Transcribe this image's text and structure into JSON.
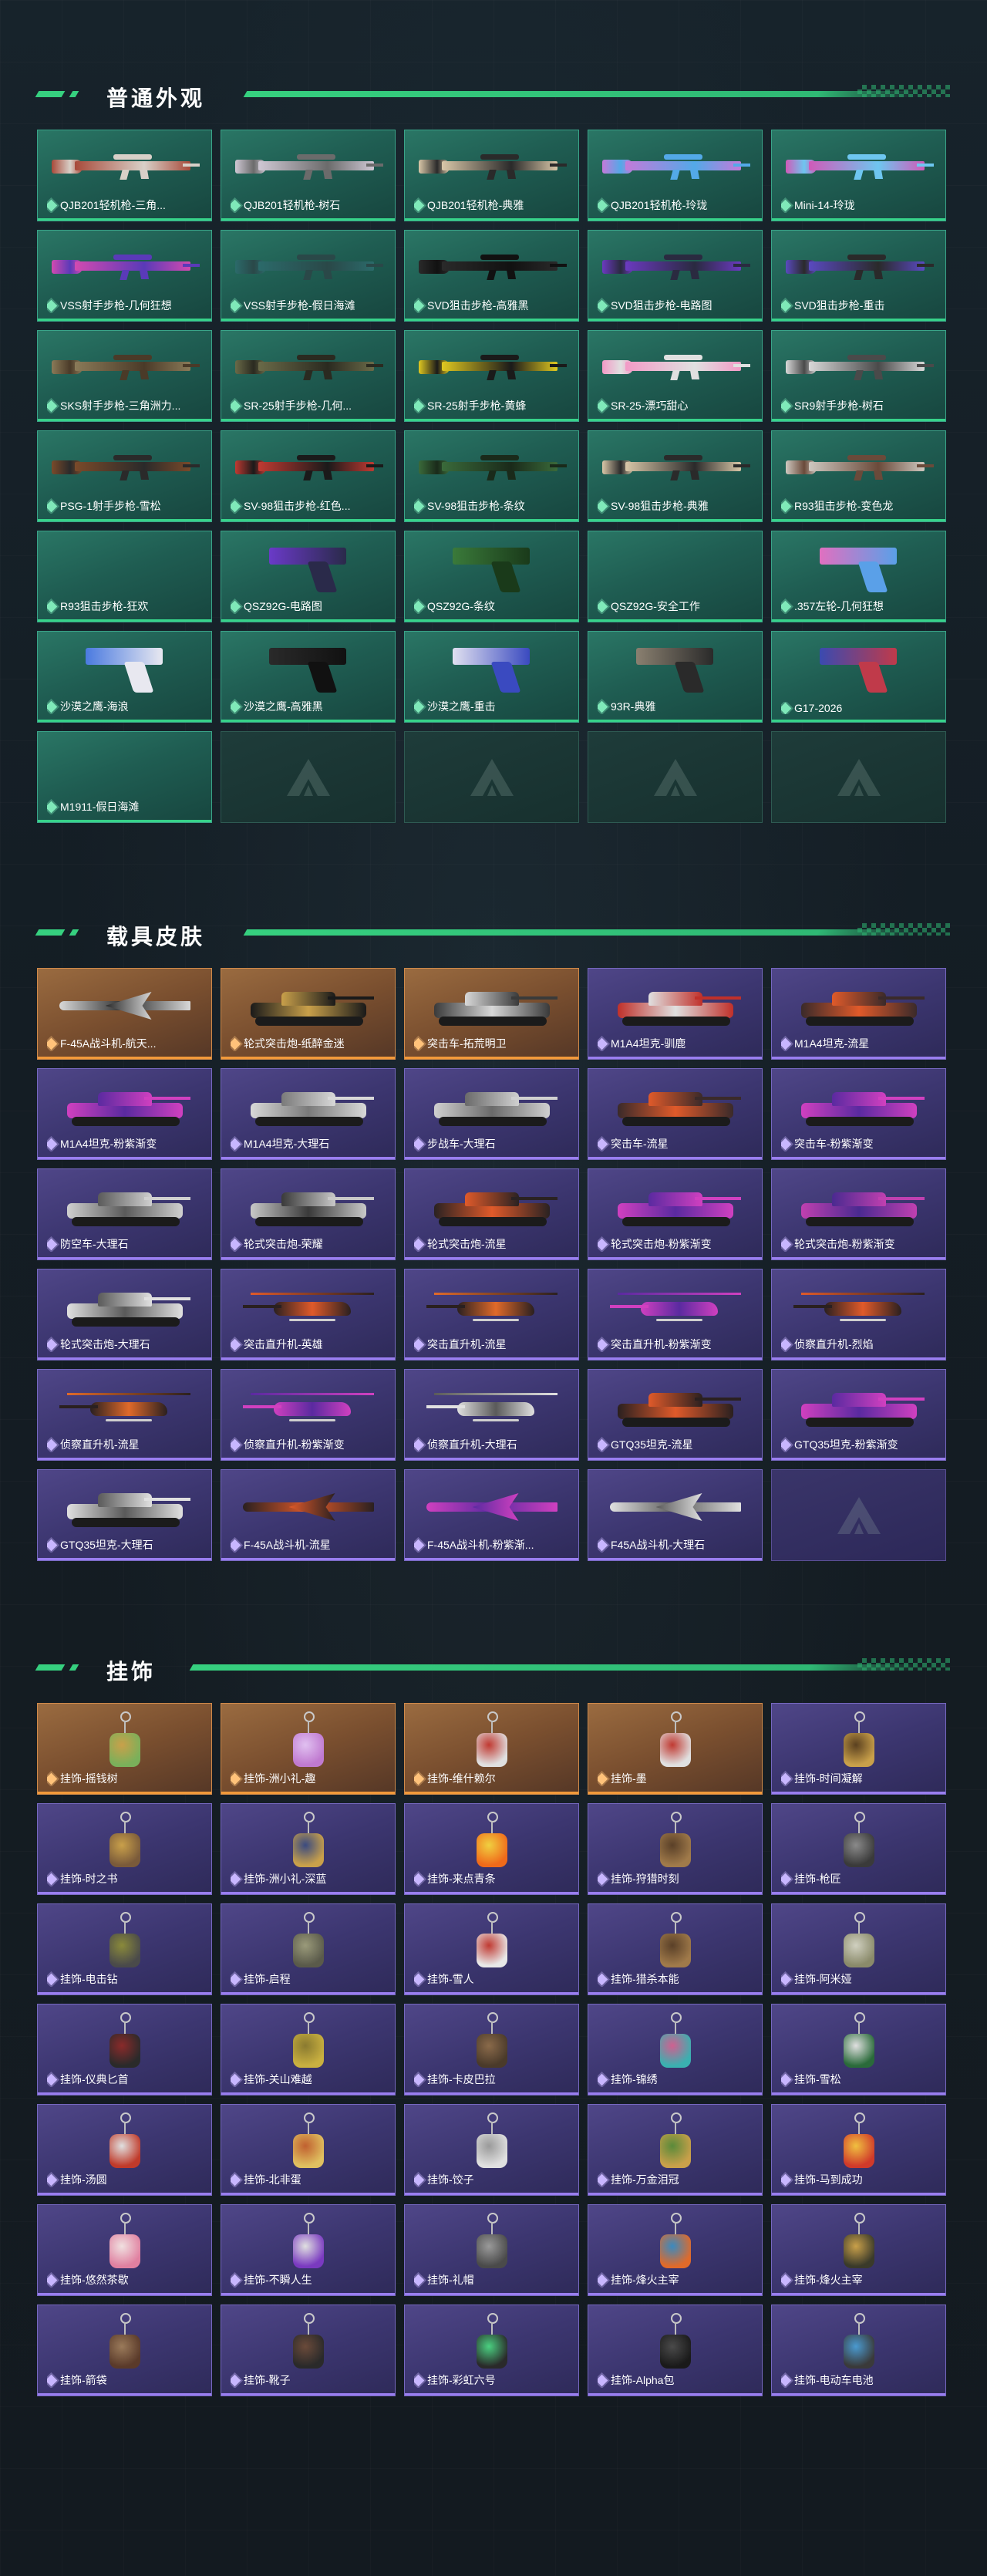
{
  "sections": [
    {
      "title": "普通外观",
      "items": [
        {
          "label": "QJB201轻机枪-三角...",
          "kind": "rifle",
          "tier": "green",
          "colors": [
            "#a84a3a",
            "#d8d0c8"
          ]
        },
        {
          "label": "QJB201轻机枪-树石",
          "kind": "rifle",
          "tier": "green",
          "colors": [
            "#cfc8d4",
            "#6b6b6b"
          ]
        },
        {
          "label": "QJB201轻机枪-典雅",
          "kind": "rifle",
          "tier": "green",
          "colors": [
            "#d9c7a8",
            "#2a2a2a"
          ]
        },
        {
          "label": "QJB201轻机枪-玲珑",
          "kind": "rifle",
          "tier": "green",
          "colors": [
            "#c37ad9",
            "#53a9e8"
          ]
        },
        {
          "label": "Mini-14-玲珑",
          "kind": "rifle",
          "tier": "green",
          "colors": [
            "#d05ab8",
            "#6ec6f0"
          ]
        },
        {
          "label": "VSS射手步枪-几何狂想",
          "kind": "rifle",
          "tier": "green",
          "colors": [
            "#d24ab0",
            "#5a3ab8"
          ]
        },
        {
          "label": "VSS射手步枪-假日海滩",
          "kind": "rifle",
          "tier": "green",
          "colors": [
            "#2b6a6a",
            "#2a4848"
          ]
        },
        {
          "label": "SVD狙击步枪-高雅黑",
          "kind": "rifle",
          "tier": "green",
          "colors": [
            "#2a2a2a",
            "#111111"
          ]
        },
        {
          "label": "SVD狙击步枪-电路图",
          "kind": "rifle",
          "tier": "green",
          "colors": [
            "#6b3ac0",
            "#2a2a40"
          ]
        },
        {
          "label": "SVD狙击步枪-重击",
          "kind": "rifle",
          "tier": "green",
          "colors": [
            "#5a4ac0",
            "#2a2a2a"
          ]
        },
        {
          "label": "SKS射手步枪-三角洲力...",
          "kind": "rifle",
          "tier": "green",
          "colors": [
            "#8a7a58",
            "#4a3a28"
          ]
        },
        {
          "label": "SR-25射手步枪-几何...",
          "kind": "rifle",
          "tier": "green",
          "colors": [
            "#6a6a48",
            "#2a2a20"
          ]
        },
        {
          "label": "SR-25射手步枪-黄蜂",
          "kind": "rifle",
          "tier": "green",
          "colors": [
            "#e0c820",
            "#1a1a1a"
          ]
        },
        {
          "label": "SR-25-漂巧甜心",
          "kind": "rifle",
          "tier": "green",
          "colors": [
            "#f29ac6",
            "#e0e0e0"
          ]
        },
        {
          "label": "SR9射手步枪-树石",
          "kind": "rifle",
          "tier": "green",
          "colors": [
            "#d8d8d8",
            "#4a4a4a"
          ]
        },
        {
          "label": "PSG-1射手步枪-雪松",
          "kind": "rifle",
          "tier": "green",
          "colors": [
            "#7a4a2a",
            "#2a2a2a"
          ]
        },
        {
          "label": "SV-98狙击步枪-红色...",
          "kind": "rifle",
          "tier": "green",
          "colors": [
            "#c03a32",
            "#1a1a1a"
          ]
        },
        {
          "label": "SV-98狙击步枪-条纹",
          "kind": "rifle",
          "tier": "green",
          "colors": [
            "#3a6a3a",
            "#1a2a1a"
          ]
        },
        {
          "label": "SV-98狙击步枪-典雅",
          "kind": "rifle",
          "tier": "green",
          "colors": [
            "#d9c7a8",
            "#2a2a2a"
          ]
        },
        {
          "label": "R93狙击步枪-变色龙",
          "kind": "rifle",
          "tier": "green",
          "colors": [
            "#cfc8c0",
            "#6a4a3a"
          ]
        },
        {
          "label": "R93狙击步枪-狂欢",
          "kind": "empty",
          "tier": "green",
          "colors": []
        },
        {
          "label": "QSZ92G-电路图",
          "kind": "pistol",
          "tier": "green",
          "colors": [
            "#6a3ac8",
            "#2a2a4a"
          ]
        },
        {
          "label": "QSZ92G-条纹",
          "kind": "pistol",
          "tier": "green",
          "colors": [
            "#3a7a3a",
            "#1a3a1a"
          ]
        },
        {
          "label": "QSZ92G-安全工作",
          "kind": "empty",
          "tier": "green",
          "colors": []
        },
        {
          "label": ".357左轮-几何狂想",
          "kind": "pistol",
          "tier": "green",
          "colors": [
            "#e070c0",
            "#5aa0e8"
          ]
        },
        {
          "label": "沙漠之鹰-海浪",
          "kind": "pistol",
          "tier": "green",
          "colors": [
            "#4a7ae0",
            "#e8e8f0"
          ]
        },
        {
          "label": "沙漠之鹰-高雅黑",
          "kind": "pistol",
          "tier": "green",
          "colors": [
            "#2a2a2a",
            "#111111"
          ]
        },
        {
          "label": "沙漠之鹰-重击",
          "kind": "pistol",
          "tier": "green",
          "colors": [
            "#e0e0f0",
            "#3a4ac0"
          ]
        },
        {
          "label": "93R-典雅",
          "kind": "pistol",
          "tier": "green",
          "colors": [
            "#8a8070",
            "#2a2a2a"
          ]
        },
        {
          "label": "G17-2026",
          "kind": "pistol",
          "tier": "green",
          "colors": [
            "#3a4ab0",
            "#c03a4a"
          ]
        },
        {
          "label": "M1911-假日海滩",
          "kind": "empty",
          "tier": "green",
          "colors": []
        },
        {
          "label": "",
          "kind": "logo",
          "tier": "empty",
          "colors": []
        },
        {
          "label": "",
          "kind": "logo",
          "tier": "empty",
          "colors": []
        },
        {
          "label": "",
          "kind": "logo",
          "tier": "empty",
          "colors": []
        },
        {
          "label": "",
          "kind": "logo",
          "tier": "empty",
          "colors": []
        }
      ]
    },
    {
      "title": "载具皮肤",
      "items": [
        {
          "label": "F-45A战斗机-航天...",
          "kind": "jet",
          "tier": "orange",
          "colors": [
            "#d8d8d8",
            "#2a2a2a"
          ]
        },
        {
          "label": "轮式突击炮-纸醉金迷",
          "kind": "veh",
          "tier": "orange",
          "colors": [
            "#1a1a1a",
            "#c9a04a"
          ]
        },
        {
          "label": "突击车-拓荒明卫",
          "kind": "veh",
          "tier": "orange",
          "colors": [
            "#3a3a3a",
            "#d8d8d8"
          ]
        },
        {
          "label": "M1A4坦克-驯鹿",
          "kind": "veh",
          "tier": "purple",
          "colors": [
            "#c0302a",
            "#e0e0e0"
          ]
        },
        {
          "label": "M1A4坦克-流星",
          "kind": "veh",
          "tier": "purple",
          "colors": [
            "#3a2a2a",
            "#e05a2a"
          ]
        },
        {
          "label": "M1A4坦克-粉紫渐变",
          "kind": "veh",
          "tier": "purple",
          "colors": [
            "#d040c0",
            "#5a2aa0"
          ]
        },
        {
          "label": "M1A4坦克-大理石",
          "kind": "veh",
          "tier": "purple",
          "colors": [
            "#d8d8d8",
            "#7a7a7a"
          ]
        },
        {
          "label": "步战车-大理石",
          "kind": "veh",
          "tier": "purple",
          "colors": [
            "#d0d0d0",
            "#6a6a6a"
          ]
        },
        {
          "label": "突击车-流星",
          "kind": "veh",
          "tier": "purple",
          "colors": [
            "#3a2a2a",
            "#e05a2a"
          ]
        },
        {
          "label": "突击车-粉紫渐变",
          "kind": "veh",
          "tier": "purple",
          "colors": [
            "#d040c0",
            "#5a2aa0"
          ]
        },
        {
          "label": "防空车-大理石",
          "kind": "veh",
          "tier": "purple",
          "colors": [
            "#d0d0d0",
            "#5a5a5a"
          ]
        },
        {
          "label": "轮式突击炮-荣耀",
          "kind": "veh",
          "tier": "purple",
          "colors": [
            "#c8c8c8",
            "#3a3a3a"
          ]
        },
        {
          "label": "轮式突击炮-流星",
          "kind": "veh",
          "tier": "purple",
          "colors": [
            "#2a2222",
            "#e05a2a"
          ]
        },
        {
          "label": "轮式突击炮-粉紫渐变",
          "kind": "veh",
          "tier": "purple",
          "colors": [
            "#d040c0",
            "#5a2aa0"
          ]
        },
        {
          "label": "轮式突击炮-粉紫渐变",
          "kind": "veh",
          "tier": "purple",
          "colors": [
            "#c040b0",
            "#4a2a90"
          ]
        },
        {
          "label": "轮式突击炮-大理石",
          "kind": "veh",
          "tier": "purple",
          "colors": [
            "#e0e0e0",
            "#5a5a5a"
          ]
        },
        {
          "label": "突击直升机-英雄",
          "kind": "heli",
          "tier": "purple",
          "colors": [
            "#2a2020",
            "#e05a2a"
          ]
        },
        {
          "label": "突击直升机-流星",
          "kind": "heli",
          "tier": "purple",
          "colors": [
            "#2a2020",
            "#e06a2a"
          ]
        },
        {
          "label": "突击直升机-粉紫渐变",
          "kind": "heli",
          "tier": "purple",
          "colors": [
            "#d040c0",
            "#5a2aa0"
          ]
        },
        {
          "label": "侦察直升机-烈焰",
          "kind": "heli",
          "tier": "purple",
          "colors": [
            "#2a2020",
            "#e05a2a"
          ]
        },
        {
          "label": "侦察直升机-流星",
          "kind": "heli",
          "tier": "purple",
          "colors": [
            "#2a2020",
            "#e06a2a"
          ]
        },
        {
          "label": "侦察直升机-粉紫渐变",
          "kind": "heli",
          "tier": "purple",
          "colors": [
            "#d040c0",
            "#5a2aa0"
          ]
        },
        {
          "label": "侦察直升机-大理石",
          "kind": "heli",
          "tier": "purple",
          "colors": [
            "#e0e0e0",
            "#5a5a5a"
          ]
        },
        {
          "label": "GTQ35坦克-流星",
          "kind": "veh",
          "tier": "purple",
          "colors": [
            "#2a2020",
            "#e05a2a"
          ]
        },
        {
          "label": "GTQ35坦克-粉紫渐变",
          "kind": "veh",
          "tier": "purple",
          "colors": [
            "#d040c0",
            "#5a2aa0"
          ]
        },
        {
          "label": "GTQ35坦克-大理石",
          "kind": "veh",
          "tier": "purple",
          "colors": [
            "#e0e0e0",
            "#5a5a5a"
          ]
        },
        {
          "label": "F-45A战斗机-流星",
          "kind": "jet",
          "tier": "purple",
          "colors": [
            "#2a2020",
            "#e05a2a"
          ]
        },
        {
          "label": "F-45A战斗机-粉紫渐...",
          "kind": "jet",
          "tier": "purple",
          "colors": [
            "#d040c0",
            "#5a2aa0"
          ]
        },
        {
          "label": "F45A战斗机-大理石",
          "kind": "jet",
          "tier": "purple",
          "colors": [
            "#e0e0e0",
            "#5a5a5a"
          ]
        },
        {
          "label": "",
          "kind": "logo",
          "tier": "empty-purple",
          "colors": []
        }
      ]
    },
    {
      "title": "挂饰",
      "items": [
        {
          "label": "挂饰-摇钱树",
          "kind": "charm",
          "tier": "orange",
          "colors": [
            "#7ab05a",
            "#c9a04a"
          ]
        },
        {
          "label": "挂饰-洲小礼-趣",
          "kind": "charm",
          "tier": "orange",
          "colors": [
            "#c07ad0",
            "#e0c0f0"
          ]
        },
        {
          "label": "挂饰-维什赖尔",
          "kind": "charm",
          "tier": "orange",
          "colors": [
            "#e0e0e0",
            "#c03a32"
          ]
        },
        {
          "label": "挂饰-墨",
          "kind": "charm",
          "tier": "orange",
          "colors": [
            "#e0e0e0",
            "#c03a32"
          ]
        },
        {
          "label": "挂饰-时间凝解",
          "kind": "charm",
          "tier": "purple",
          "colors": [
            "#c9a04a",
            "#5a4020"
          ]
        },
        {
          "label": "挂饰-时之书",
          "kind": "charm",
          "tier": "purple",
          "colors": [
            "#7a5a3a",
            "#c9a04a"
          ]
        },
        {
          "label": "挂饰-洲小礼-深蓝",
          "kind": "charm",
          "tier": "purple",
          "colors": [
            "#c9a04a",
            "#3a4a80"
          ]
        },
        {
          "label": "挂饰-来点青条",
          "kind": "charm",
          "tier": "purple",
          "colors": [
            "#f06a1a",
            "#f0d040"
          ]
        },
        {
          "label": "挂饰-狩猎时刻",
          "kind": "charm",
          "tier": "purple",
          "colors": [
            "#a07a4a",
            "#5a4028"
          ]
        },
        {
          "label": "挂饰-枪匠",
          "kind": "charm",
          "tier": "purple",
          "colors": [
            "#3a3a3a",
            "#8a8a8a"
          ]
        },
        {
          "label": "挂饰-电击钻",
          "kind": "charm",
          "tier": "purple",
          "colors": [
            "#4a4a4a",
            "#8a8a3a"
          ]
        },
        {
          "label": "挂饰-启程",
          "kind": "charm",
          "tier": "purple",
          "colors": [
            "#5a5a4a",
            "#9a9a7a"
          ]
        },
        {
          "label": "挂饰-雪人",
          "kind": "charm",
          "tier": "purple",
          "colors": [
            "#e8e8e8",
            "#c03a32"
          ]
        },
        {
          "label": "挂饰-猎杀本能",
          "kind": "charm",
          "tier": "purple",
          "colors": [
            "#a07a4a",
            "#5a4028"
          ]
        },
        {
          "label": "挂饰-阿米娅",
          "kind": "charm",
          "tier": "purple",
          "colors": [
            "#8a8a6a",
            "#d0d0c0"
          ]
        },
        {
          "label": "挂饰-仪典匕首",
          "kind": "charm",
          "tier": "purple",
          "colors": [
            "#2a2a2a",
            "#8a2a2a"
          ]
        },
        {
          "label": "挂饰-关山难越",
          "kind": "charm",
          "tier": "purple",
          "colors": [
            "#c9b040",
            "#8a7a30"
          ]
        },
        {
          "label": "挂饰-卡皮巴拉",
          "kind": "charm",
          "tier": "purple",
          "colors": [
            "#4a3a2a",
            "#8a6a4a"
          ]
        },
        {
          "label": "挂饰-锦绣",
          "kind": "charm",
          "tier": "purple",
          "colors": [
            "#3ab0b0",
            "#d06090"
          ]
        },
        {
          "label": "挂饰-雪松",
          "kind": "charm",
          "tier": "purple",
          "colors": [
            "#2a6a3a",
            "#e0e0e0"
          ]
        },
        {
          "label": "挂饰-汤圆",
          "kind": "charm",
          "tier": "purple",
          "colors": [
            "#c03a2a",
            "#e0e0e0"
          ]
        },
        {
          "label": "挂饰-北非蛋",
          "kind": "charm",
          "tier": "purple",
          "colors": [
            "#e0c060",
            "#c06030"
          ]
        },
        {
          "label": "挂饰-饺子",
          "kind": "charm",
          "tier": "purple",
          "colors": [
            "#e0e0e0",
            "#9a9a9a"
          ]
        },
        {
          "label": "挂饰-万金泪冠",
          "kind": "charm",
          "tier": "purple",
          "colors": [
            "#c9a04a",
            "#5a8a3a"
          ]
        },
        {
          "label": "挂饰-马到成功",
          "kind": "charm",
          "tier": "purple",
          "colors": [
            "#d03a2a",
            "#f0c040"
          ]
        },
        {
          "label": "挂饰-悠然茶歇",
          "kind": "charm",
          "tier": "purple",
          "colors": [
            "#e080a0",
            "#f0e0e0"
          ]
        },
        {
          "label": "挂饰-不瞬人生",
          "kind": "charm",
          "tier": "purple",
          "colors": [
            "#7a3ac0",
            "#e0e0e0"
          ]
        },
        {
          "label": "挂饰-礼帽",
          "kind": "charm",
          "tier": "purple",
          "colors": [
            "#4a4a4a",
            "#9a9a9a"
          ]
        },
        {
          "label": "挂饰-烽火主宰",
          "kind": "charm",
          "tier": "purple",
          "colors": [
            "#e06a2a",
            "#3a8ac0"
          ]
        },
        {
          "label": "挂饰-烽火主宰",
          "kind": "charm",
          "tier": "purple",
          "colors": [
            "#3a3a2a",
            "#c9a04a"
          ]
        },
        {
          "label": "挂饰-箭袋",
          "kind": "charm",
          "tier": "purple",
          "colors": [
            "#5a3a2a",
            "#9a7a5a"
          ]
        },
        {
          "label": "挂饰-靴子",
          "kind": "charm",
          "tier": "purple",
          "colors": [
            "#2a2a2a",
            "#6a4a3a"
          ]
        },
        {
          "label": "挂饰-彩虹六号",
          "kind": "charm",
          "tier": "purple",
          "colors": [
            "#2a2a2a",
            "#4ad080"
          ]
        },
        {
          "label": "挂饰-Alpha包",
          "kind": "charm",
          "tier": "purple",
          "colors": [
            "#1a1a1a",
            "#4a4a4a"
          ]
        },
        {
          "label": "挂饰-电动车电池",
          "kind": "charm",
          "tier": "purple",
          "colors": [
            "#3a3a3a",
            "#4a9ad0"
          ]
        }
      ]
    }
  ]
}
